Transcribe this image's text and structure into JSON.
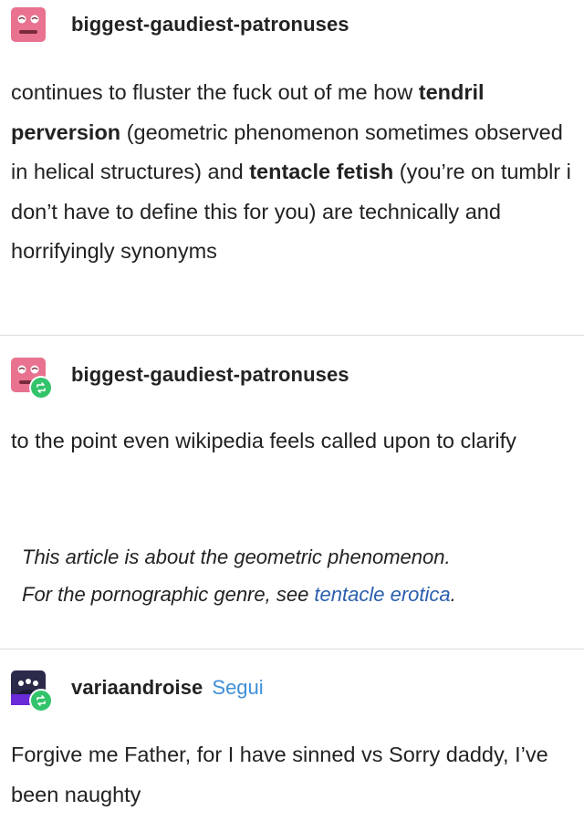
{
  "post1": {
    "username": "biggest-gaudiest-patronuses",
    "text_pre": "continues to fluster the fuck out of me how ",
    "bold1": "tendril perversion",
    "text_mid1": " (geometric phenomenon sometimes observed in helical structures) and ",
    "bold2": "tentacle fetish",
    "text_mid2": " (you’re on tumblr i don’t have to define this for you) are technically and horrifyingly synonyms"
  },
  "post2": {
    "username": "biggest-gaudiest-patronuses",
    "text": "to the point even wikipedia feels called upon to clarify",
    "quote_line1": "This article is about the geometric phenomenon.",
    "quote_pre": "For the pornographic genre, see ",
    "quote_link": "tentacle erotica",
    "quote_post": "."
  },
  "post3": {
    "username": "variaandroise",
    "follow_label": "Segui",
    "text": "Forgive me Father, for I have sinned vs Sorry daddy, I’ve been naughty"
  },
  "colors": {
    "avatar_pink": "#e8728f",
    "avatar_dark": "#2b2a4a",
    "reblog_green": "#33c36b",
    "follow_blue": "#3d8fd9",
    "link_blue": "#2b5fad"
  }
}
